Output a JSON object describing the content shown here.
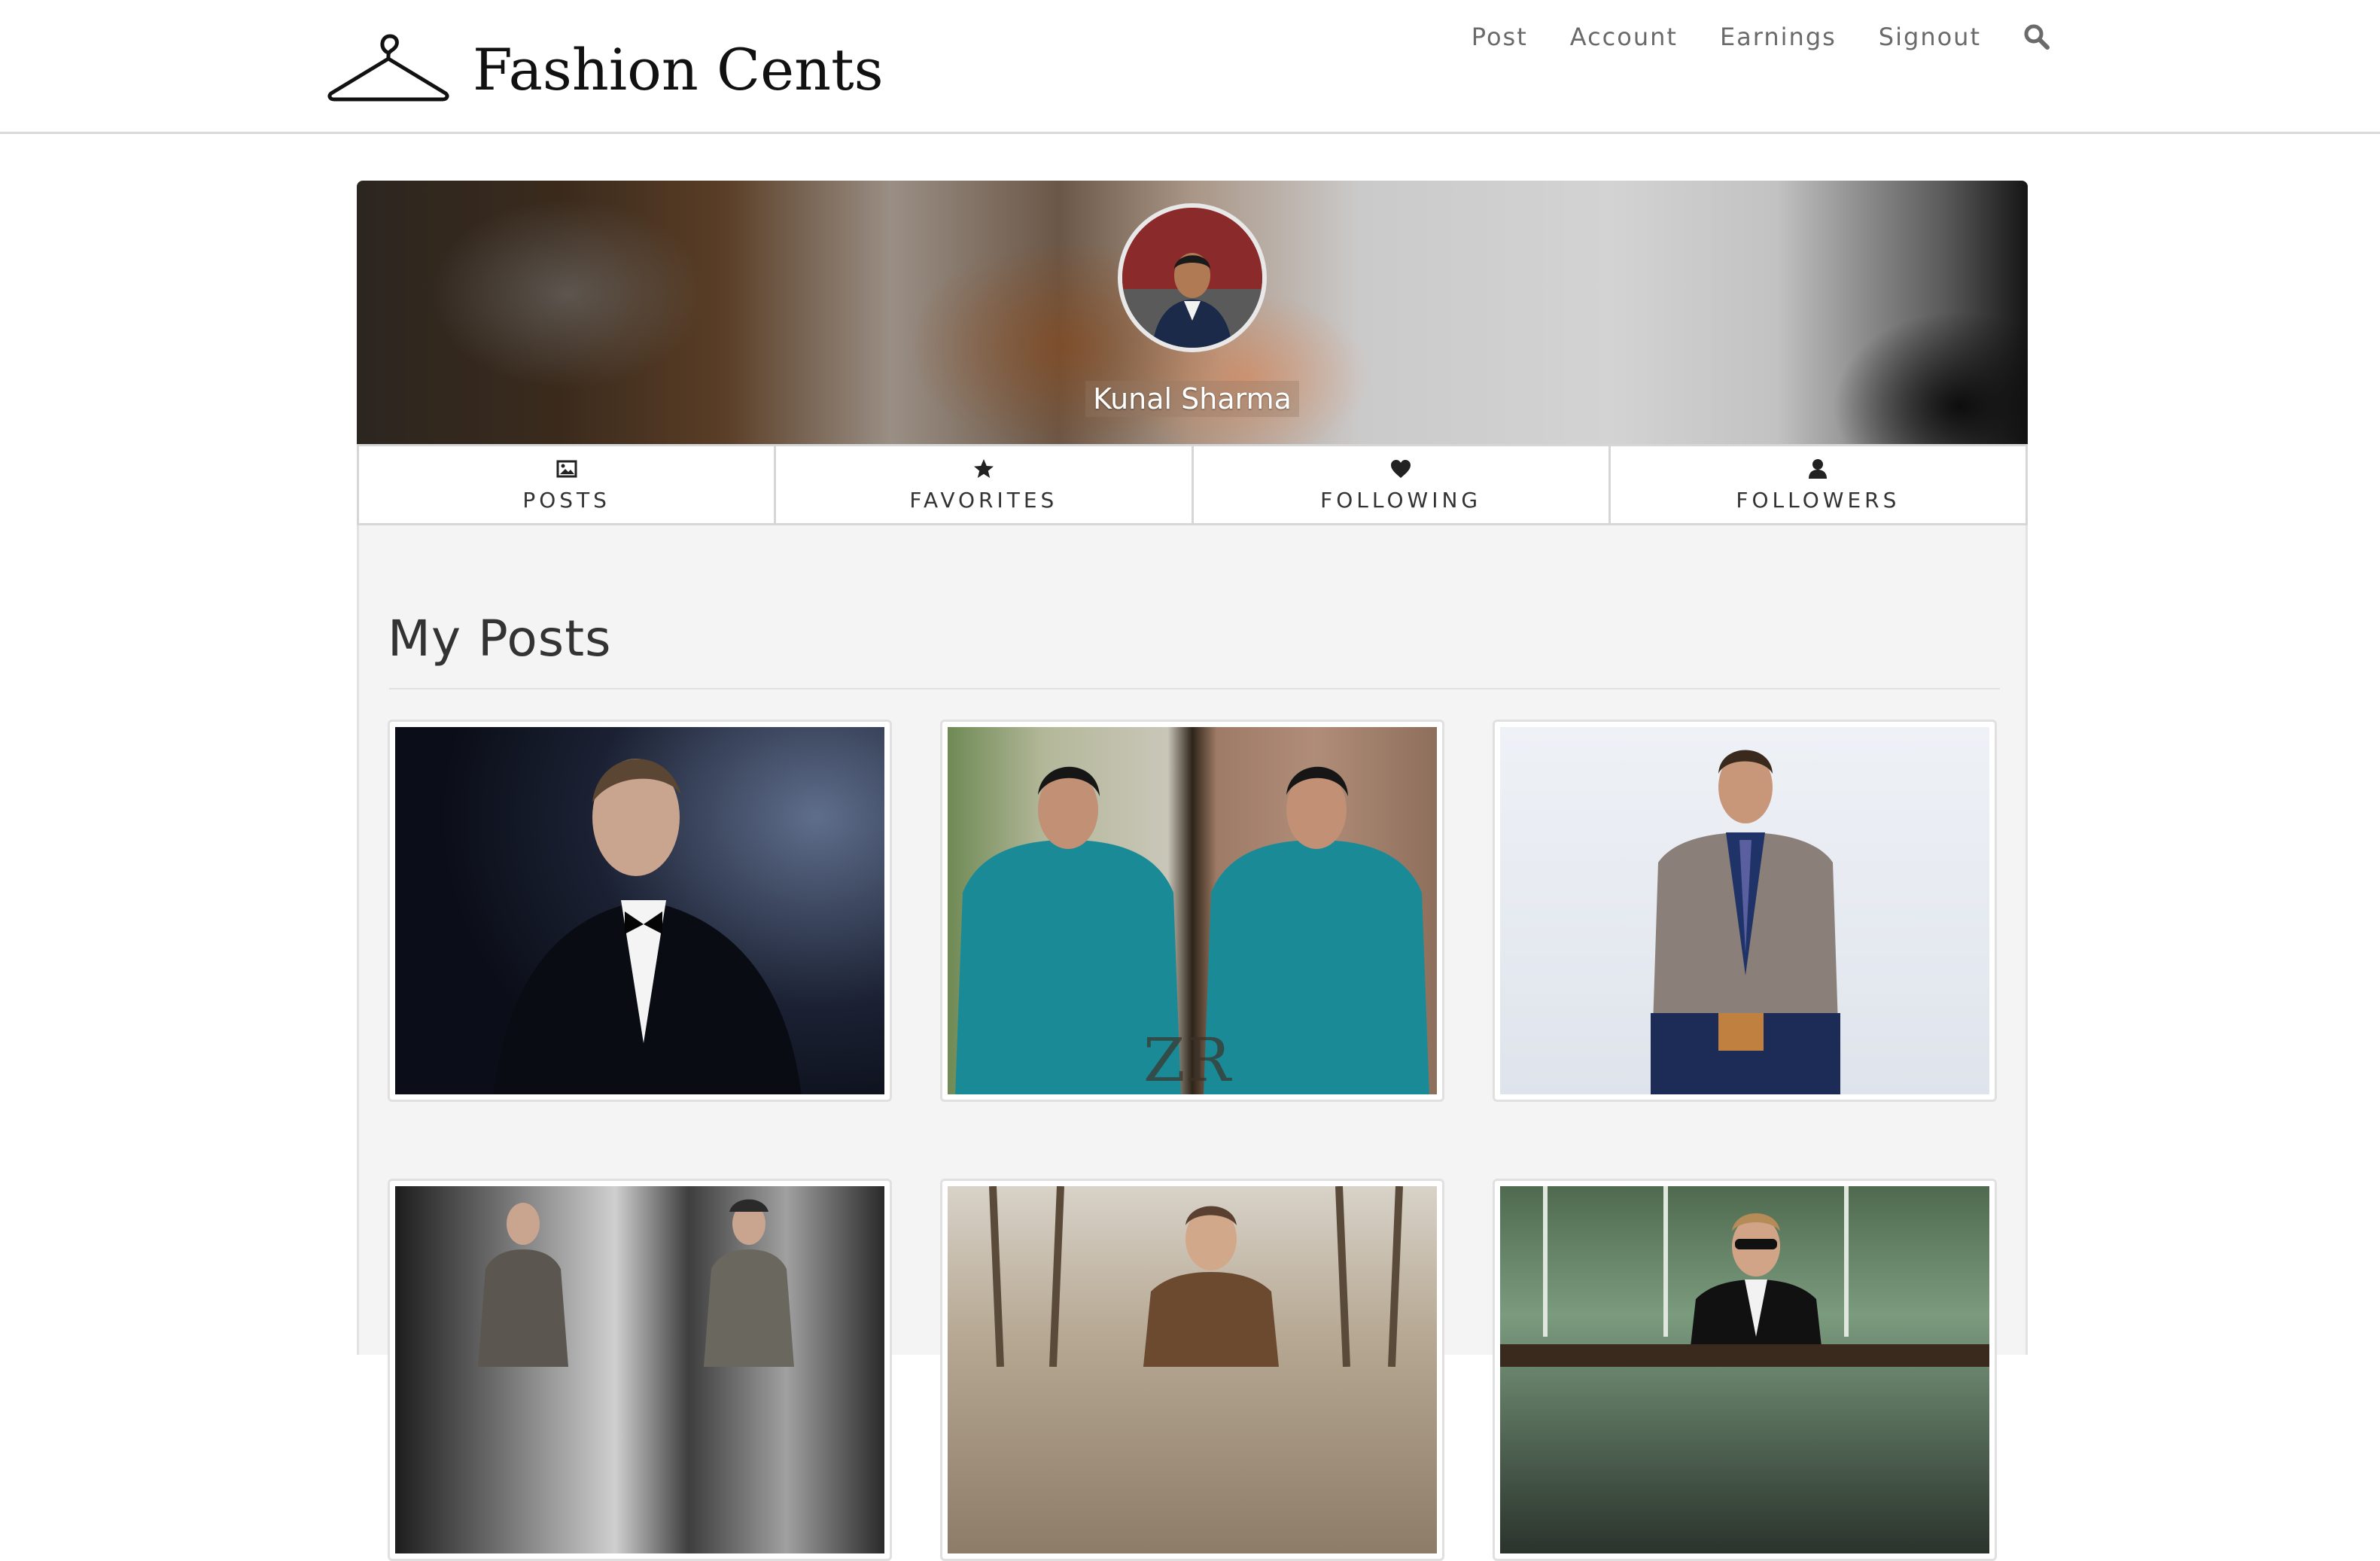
{
  "header": {
    "logo_text": "Fashion Cents",
    "nav": [
      "Post",
      "Account",
      "Earnings",
      "Signout"
    ]
  },
  "profile": {
    "name": "Kunal Sharma"
  },
  "tabs": [
    {
      "label": "POSTS",
      "icon": "image-icon"
    },
    {
      "label": "FAVORITES",
      "icon": "star-icon"
    },
    {
      "label": "FOLLOWING",
      "icon": "heart-icon"
    },
    {
      "label": "FOLLOWERS",
      "icon": "user-icon"
    }
  ],
  "main": {
    "title": "My Posts",
    "posts_count_visible": 6
  }
}
